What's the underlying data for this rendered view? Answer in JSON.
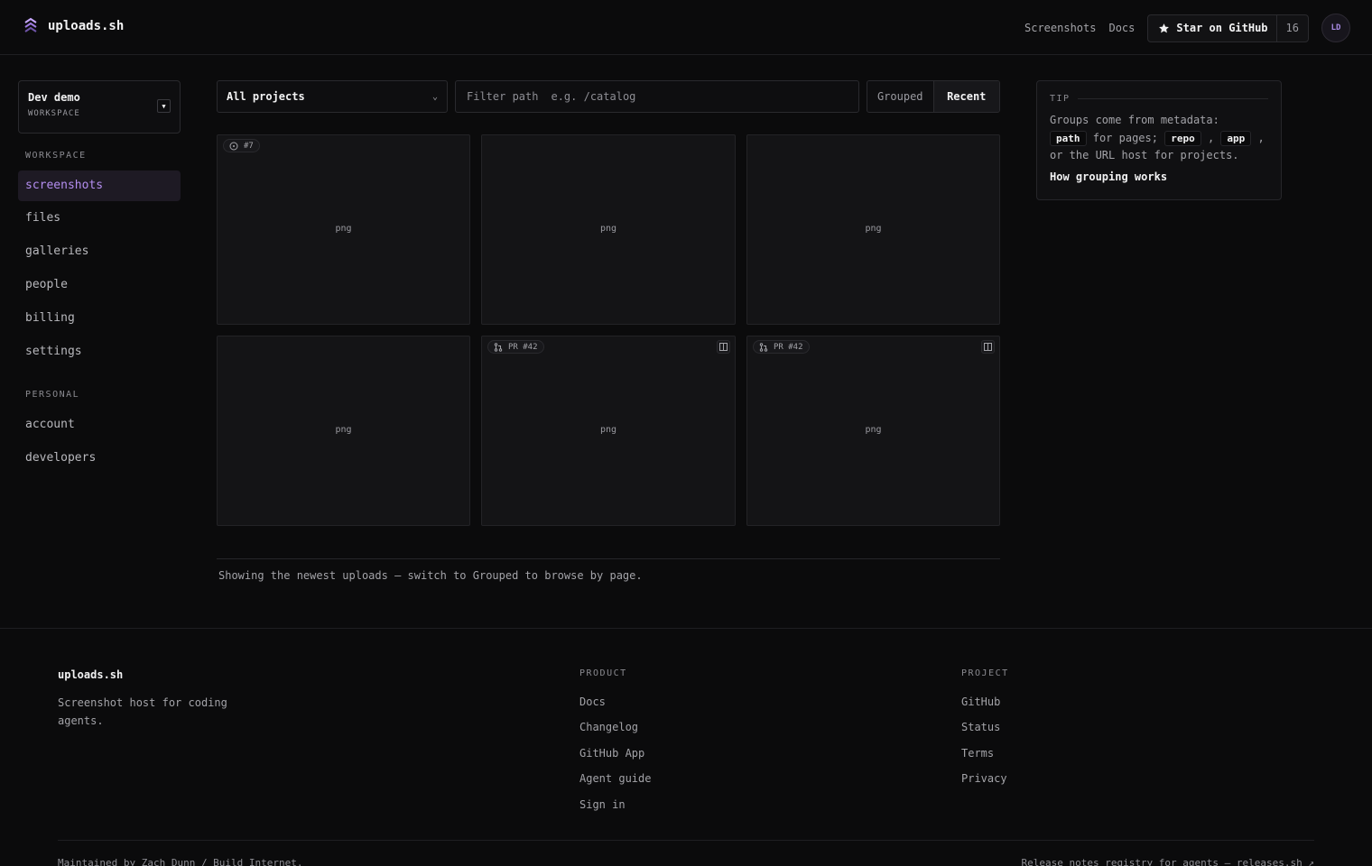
{
  "app": {
    "name": "uploads.sh"
  },
  "nav": {
    "screenshots": "Screenshots",
    "docs": "Docs",
    "star_label": "Star on GitHub",
    "star_count": "16",
    "avatar_initials": "LD"
  },
  "workspace": {
    "name": "Dev demo",
    "label": "WORKSPACE"
  },
  "sidebar": {
    "workspace_section": "WORKSPACE",
    "workspace_items": [
      "screenshots",
      "files",
      "galleries",
      "people",
      "billing",
      "settings"
    ],
    "personal_section": "PERSONAL",
    "personal_items": [
      "account",
      "developers"
    ],
    "active": "screenshots"
  },
  "toolbar": {
    "project_select": "All projects",
    "filter_label": "Filter path",
    "filter_placeholder": "e.g. /catalog",
    "view_grouped": "Grouped",
    "view_recent": "Recent"
  },
  "cards": [
    {
      "type": "png",
      "badge": "#7"
    },
    {
      "type": "png"
    },
    {
      "type": "png"
    },
    {
      "type": "png"
    },
    {
      "type": "png",
      "badge": "PR #42"
    },
    {
      "type": "png",
      "badge": "PR #42"
    }
  ],
  "hint": "Showing the newest uploads — switch to Grouped to browse by page.",
  "tip": {
    "title": "TIP",
    "line1": "Groups come from metadata:",
    "code_path": "path",
    "text_for_pages": "for pages;",
    "code_repo": "repo",
    "code_app": "app",
    "text_or": "or the URL host for projects.",
    "link": "How grouping works"
  },
  "footer": {
    "brand": "uploads.sh",
    "description": "Screenshot host for coding agents.",
    "product_title": "PRODUCT",
    "product_links": [
      "Docs",
      "Changelog",
      "GitHub App",
      "Agent guide",
      "Sign in"
    ],
    "project_title": "PROJECT",
    "project_links": [
      "GitHub",
      "Status",
      "Terms",
      "Privacy"
    ],
    "maintained": "Maintained by Zach Dunn / Build Internet.",
    "release_notes": "Release notes registry for agents — releases.sh ↗"
  },
  "colors": {
    "accent": "#b48ef0",
    "background": "#0b0b0c",
    "card": "#141416"
  }
}
